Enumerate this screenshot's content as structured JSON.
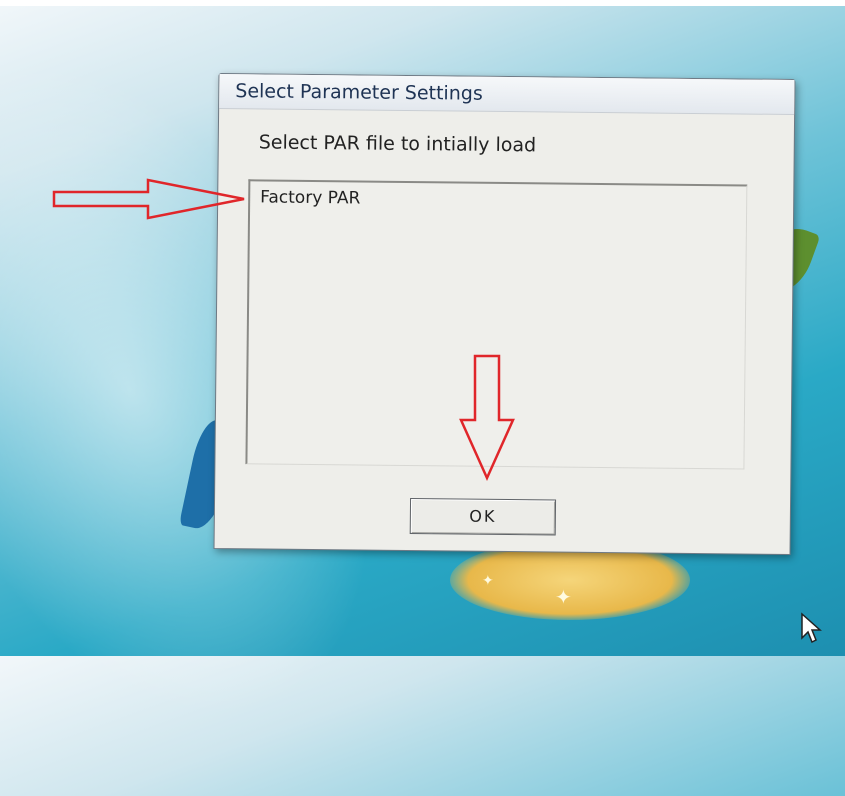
{
  "dialog": {
    "title": "Select Parameter Settings",
    "prompt": "Select PAR file to intially load",
    "list_items": [
      "Factory PAR"
    ],
    "ok_label": "OK"
  },
  "annotations": {
    "arrow_color": "#e0262a",
    "arrows": [
      "right-arrow-annotation",
      "down-arrow-annotation"
    ]
  },
  "colors": {
    "desktop_accent": "#2aa9c6",
    "dialog_bg": "#eeeeea",
    "title_text": "#1e3354"
  },
  "icons": [
    "mouse-cursor-icon"
  ]
}
